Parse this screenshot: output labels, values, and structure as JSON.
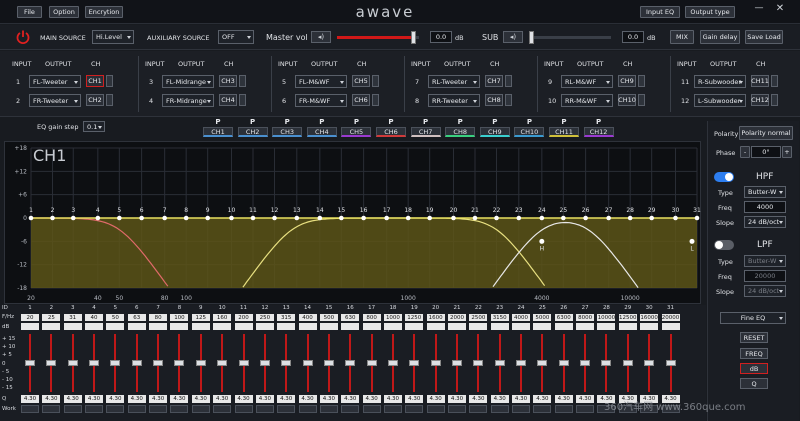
{
  "menu": {
    "file": "File",
    "option": "Option",
    "encryption": "Encrytion"
  },
  "logo": "awave",
  "header": {
    "input_eq": "Input EQ",
    "output_type": "Output type"
  },
  "window": {
    "minimize": "—",
    "close": "✕"
  },
  "source": {
    "main_label": "MAIN SOURCE",
    "main_value": "Hi.Level",
    "aux_label": "AUXILIARY SOURCE",
    "aux_value": "OFF",
    "master_label": "Master vol",
    "master_value": "0.0",
    "master_unit": "dB",
    "master_level": 0.93,
    "sub_label": "SUB",
    "sub_value": "0.0",
    "sub_unit": "dB",
    "sub_level": 0.02,
    "mix": "MIX",
    "gain_delay": "Gain delay",
    "save_load": "Save Load"
  },
  "routing_headers": {
    "input": "INPUT",
    "output": "OUTPUT",
    "ch": "CH"
  },
  "routing": [
    {
      "input": "1",
      "output": "FL-Tweeter",
      "ch": "CH1"
    },
    {
      "input": "2",
      "output": "FR-Tweeter",
      "ch": "CH2"
    },
    {
      "input": "3",
      "output": "FL-Midrange",
      "ch": "CH3"
    },
    {
      "input": "4",
      "output": "FR-Midrange",
      "ch": "CH4"
    },
    {
      "input": "5",
      "output": "FL-M&WF",
      "ch": "CH5"
    },
    {
      "input": "6",
      "output": "FR-M&WF",
      "ch": "CH6"
    },
    {
      "input": "7",
      "output": "RL-Tweeter",
      "ch": "CH7"
    },
    {
      "input": "8",
      "output": "RR-Tweeter",
      "ch": "CH8"
    },
    {
      "input": "9",
      "output": "RL-M&WF",
      "ch": "CH9"
    },
    {
      "input": "10",
      "output": "RR-M&WF",
      "ch": "CH10"
    },
    {
      "input": "11",
      "output": "R-Subwooder",
      "ch": "CH11"
    },
    {
      "input": "12",
      "output": "L-Subwooder",
      "ch": "CH12"
    }
  ],
  "eq_step": {
    "label": "EQ gain step",
    "value": "0.1"
  },
  "group_buttons": [
    {
      "p": "P",
      "label": "CH1",
      "color": "#4a90d0"
    },
    {
      "p": "P",
      "label": "CH2",
      "color": "#4a90d0"
    },
    {
      "p": "P",
      "label": "CH3",
      "color": "#4a90d0"
    },
    {
      "p": "P",
      "label": "CH4",
      "color": "#4a90d0"
    },
    {
      "p": "P",
      "label": "CH5",
      "color": "#9a3ad0"
    },
    {
      "p": "P",
      "label": "CH6",
      "color": "#d03a3a"
    },
    {
      "p": "P",
      "label": "CH7",
      "color": "#d0c0c0"
    },
    {
      "p": "P",
      "label": "CH8",
      "color": "#3ad080"
    },
    {
      "p": "P",
      "label": "CH9",
      "color": "#3ad0d0"
    },
    {
      "p": "P",
      "label": "CH10",
      "color": "#3a9ad0"
    },
    {
      "p": "P",
      "label": "CH11",
      "color": "#d0c03a"
    },
    {
      "p": "P",
      "label": "CH12",
      "color": "#9a3ad0"
    }
  ],
  "graph": {
    "channel": "CH1",
    "y_ticks": [
      "+18",
      "+12",
      "+6",
      "0",
      "-6",
      "-12",
      "-18"
    ],
    "x_ticks": [
      "20",
      "40",
      "50",
      "80",
      "100",
      "1000",
      "4000",
      "10000"
    ],
    "band_numbers": [
      "1",
      "2",
      "3",
      "4",
      "5",
      "6",
      "7",
      "8",
      "9",
      "10",
      "11",
      "12",
      "13",
      "14",
      "15",
      "16",
      "17",
      "18",
      "19",
      "20",
      "21",
      "22",
      "23",
      "24",
      "25",
      "26",
      "27",
      "28",
      "29",
      "30",
      "31"
    ],
    "hpf_marker": "H",
    "lpf_marker": "L"
  },
  "right_panel": {
    "polarity_label": "Polarity",
    "polarity_value": "Polarity normal",
    "phase_label": "Phase",
    "phase_minus": "-",
    "phase_value": "0°",
    "phase_plus": "+",
    "hpf": {
      "title": "HPF",
      "on": true,
      "type_label": "Type",
      "type_value": "Butter-W",
      "freq_label": "Freq",
      "freq_value": "4000",
      "slope_label": "Slope",
      "slope_value": "24 dB/oct"
    },
    "lpf": {
      "title": "LPF",
      "on": false,
      "type_label": "Type",
      "type_value": "Butter-W",
      "freq_label": "Freq",
      "freq_value": "20000",
      "slope_label": "Slope",
      "slope_value": "24 dB/oct"
    },
    "fine_eq": "Fine EQ",
    "reset": "RESET",
    "freq": "FREQ",
    "db": "dB",
    "q": "Q"
  },
  "bands": {
    "row_labels": {
      "id": "ID",
      "freq": "F/Hz",
      "db": "dB",
      "q": "Q",
      "work": "Work"
    },
    "ids": [
      "1",
      "2",
      "3",
      "4",
      "5",
      "6",
      "7",
      "8",
      "9",
      "10",
      "11",
      "12",
      "13",
      "14",
      "15",
      "16",
      "17",
      "18",
      "19",
      "20",
      "21",
      "22",
      "23",
      "24",
      "25",
      "26",
      "27",
      "28",
      "29",
      "30",
      "31"
    ],
    "freqs": [
      "20",
      "25",
      "31",
      "40",
      "50",
      "63",
      "80",
      "100",
      "125",
      "160",
      "200",
      "250",
      "315",
      "400",
      "500",
      "630",
      "800",
      "1000",
      "1250",
      "1600",
      "2000",
      "2500",
      "3150",
      "4000",
      "5000",
      "6300",
      "8000",
      "10000",
      "12500",
      "16000",
      "20000"
    ],
    "db": [
      "0",
      "0",
      "0",
      "0",
      "0",
      "0",
      "0",
      "0",
      "0",
      "0",
      "0",
      "0",
      "0",
      "0",
      "0",
      "0",
      "0",
      "0",
      "0",
      "0",
      "0",
      "0",
      "0",
      "0",
      "0",
      "0",
      "0",
      "0",
      "0",
      "0",
      "0"
    ],
    "q": [
      "4.30",
      "4.30",
      "4.30",
      "4.30",
      "4.30",
      "4.30",
      "4.30",
      "4.30",
      "4.30",
      "4.30",
      "4.30",
      "4.30",
      "4.30",
      "4.30",
      "4.30",
      "4.30",
      "4.30",
      "4.30",
      "4.30",
      "4.30",
      "4.30",
      "4.30",
      "4.30",
      "4.30",
      "4.30",
      "4.30",
      "4.30",
      "4.30",
      "4.30",
      "4.30",
      "4.30"
    ],
    "scale": [
      "+ 15",
      "+ 10",
      "+ 5",
      "0",
      "- 5",
      "- 10",
      "- 15"
    ]
  },
  "watermark": "360汽车网 www.360que.com"
}
